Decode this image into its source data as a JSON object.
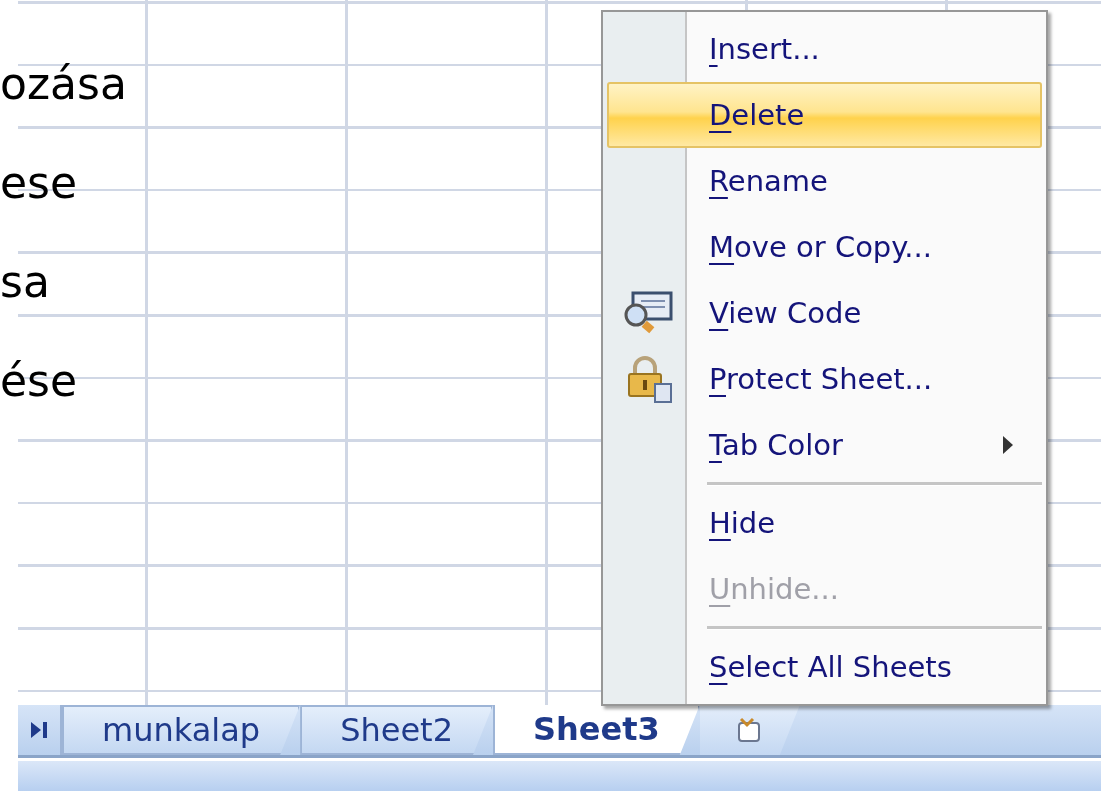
{
  "sheet": {
    "text_lines": [
      "ozása",
      "ese",
      "sa",
      "ése"
    ]
  },
  "sheet_tabs": [
    {
      "label": "munkalap",
      "selected": false
    },
    {
      "label": "Sheet2",
      "selected": false
    },
    {
      "label": "Sheet3",
      "selected": true
    }
  ],
  "context_menu": {
    "items": [
      {
        "kind": "item",
        "label": "Insert...",
        "selected": false,
        "disabled": false
      },
      {
        "kind": "item",
        "label": "Delete",
        "selected": true,
        "disabled": false
      },
      {
        "kind": "item",
        "label": "Rename",
        "selected": false,
        "disabled": false
      },
      {
        "kind": "item",
        "label": "Move or Copy...",
        "selected": false,
        "disabled": false
      },
      {
        "kind": "code",
        "label": "View Code",
        "selected": false,
        "disabled": false
      },
      {
        "kind": "lock",
        "label": "Protect Sheet...",
        "selected": false,
        "disabled": false
      },
      {
        "kind": "submenu",
        "label": "Tab Color",
        "selected": false,
        "disabled": false
      },
      {
        "kind": "separator"
      },
      {
        "kind": "item",
        "label": "Hide",
        "selected": false,
        "disabled": false
      },
      {
        "kind": "item",
        "label": "Unhide...",
        "selected": false,
        "disabled": true
      },
      {
        "kind": "separator"
      },
      {
        "kind": "item",
        "label": "Select All Sheets",
        "selected": false,
        "disabled": false
      }
    ]
  }
}
